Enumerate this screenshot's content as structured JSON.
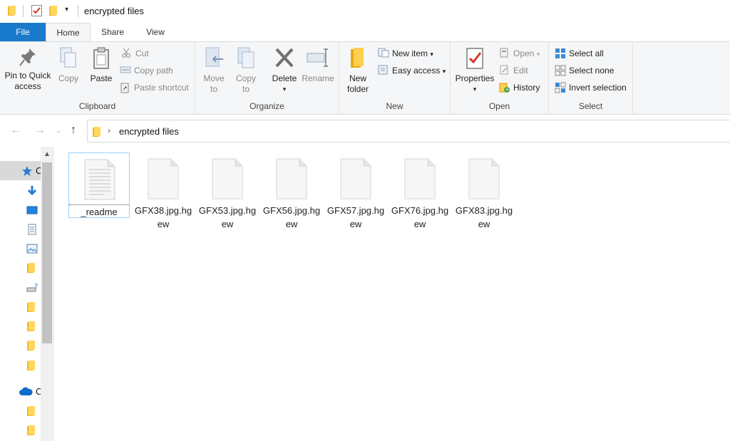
{
  "window": {
    "title": "encrypted files"
  },
  "tabs": {
    "file": "File",
    "home": "Home",
    "share": "Share",
    "view": "View"
  },
  "ribbon": {
    "clipboard": {
      "label": "Clipboard",
      "pin_line1": "Pin to Quick",
      "pin_line2": "access",
      "copy": "Copy",
      "paste": "Paste",
      "cut": "Cut",
      "copy_path": "Copy path",
      "paste_shortcut": "Paste shortcut"
    },
    "organize": {
      "label": "Organize",
      "move_line1": "Move",
      "move_line2": "to",
      "copy_line1": "Copy",
      "copy_line2": "to",
      "delete": "Delete",
      "rename": "Rename"
    },
    "new": {
      "label": "New",
      "new_folder_line1": "New",
      "new_folder_line2": "folder",
      "new_item": "New item",
      "easy_access": "Easy access"
    },
    "open": {
      "label": "Open",
      "properties": "Properties",
      "open": "Open",
      "edit": "Edit",
      "history": "History"
    },
    "select": {
      "label": "Select",
      "select_all": "Select all",
      "select_none": "Select none",
      "invert": "Invert selection"
    }
  },
  "address": {
    "path": "encrypted files"
  },
  "navpane": {
    "items": [
      {
        "icon": "star-icon",
        "label": "C"
      },
      {
        "icon": "download-icon",
        "label": ""
      },
      {
        "icon": "desktop-icon",
        "label": ""
      },
      {
        "icon": "document-icon",
        "label": ""
      },
      {
        "icon": "pictures-icon",
        "label": ""
      },
      {
        "icon": "folder-icon",
        "label": ""
      },
      {
        "icon": "network-drive-icon",
        "label": ""
      },
      {
        "icon": "folder-icon",
        "label": ""
      },
      {
        "icon": "folder-icon",
        "label": ""
      },
      {
        "icon": "folder-icon",
        "label": ""
      },
      {
        "icon": "folder-icon",
        "label": ""
      },
      {
        "icon": "cloud-icon",
        "label": "C"
      },
      {
        "icon": "folder-icon",
        "label": ""
      },
      {
        "icon": "folder-icon",
        "label": ""
      }
    ]
  },
  "files": [
    {
      "name": "_readme",
      "icon": "text-file-icon"
    },
    {
      "name": "GFX38.jpg.hgew",
      "icon": "blank-file-icon"
    },
    {
      "name": "GFX53.jpg.hgew",
      "icon": "blank-file-icon"
    },
    {
      "name": "GFX56.jpg.hgew",
      "icon": "blank-file-icon"
    },
    {
      "name": "GFX57.jpg.hgew",
      "icon": "blank-file-icon"
    },
    {
      "name": "GFX76.jpg.hgew",
      "icon": "blank-file-icon"
    },
    {
      "name": "GFX83.jpg.hgew",
      "icon": "blank-file-icon"
    }
  ],
  "colors": {
    "accent": "#1979ca",
    "ribbon_bg": "#f5f6f7",
    "folder": "#f7c948"
  }
}
